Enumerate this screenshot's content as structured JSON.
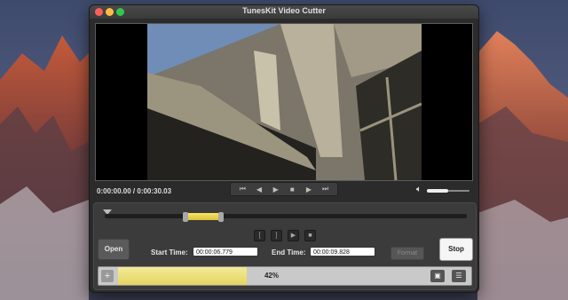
{
  "window": {
    "title": "TunesKit Video Cutter"
  },
  "player": {
    "time_readout": "0:00:00.00 / 0:00:30.03",
    "volume_level": 0.5
  },
  "controls": {
    "open_label": "Open",
    "start_time_label": "Start Time:",
    "start_time_value": "00:00:06.779",
    "end_time_label": "End Time:",
    "end_time_value": "00:00:09.828",
    "format_label": "Format",
    "stop_label": "Stop"
  },
  "progress": {
    "fraction": 0.42,
    "text": "42%"
  },
  "colors": {
    "selection": "#e9d54a",
    "progress": "#f0e385",
    "close": "#fc605c",
    "minimize": "#fdbc40",
    "maximize": "#34c84a"
  },
  "icons": {
    "playback": [
      "previous-frame-icon",
      "step-back-icon",
      "play-icon",
      "stop-icon",
      "step-forward-icon",
      "next-frame-icon"
    ],
    "segment": [
      "mark-in-icon",
      "mark-out-icon",
      "play-segment-icon",
      "stop-segment-icon"
    ]
  }
}
